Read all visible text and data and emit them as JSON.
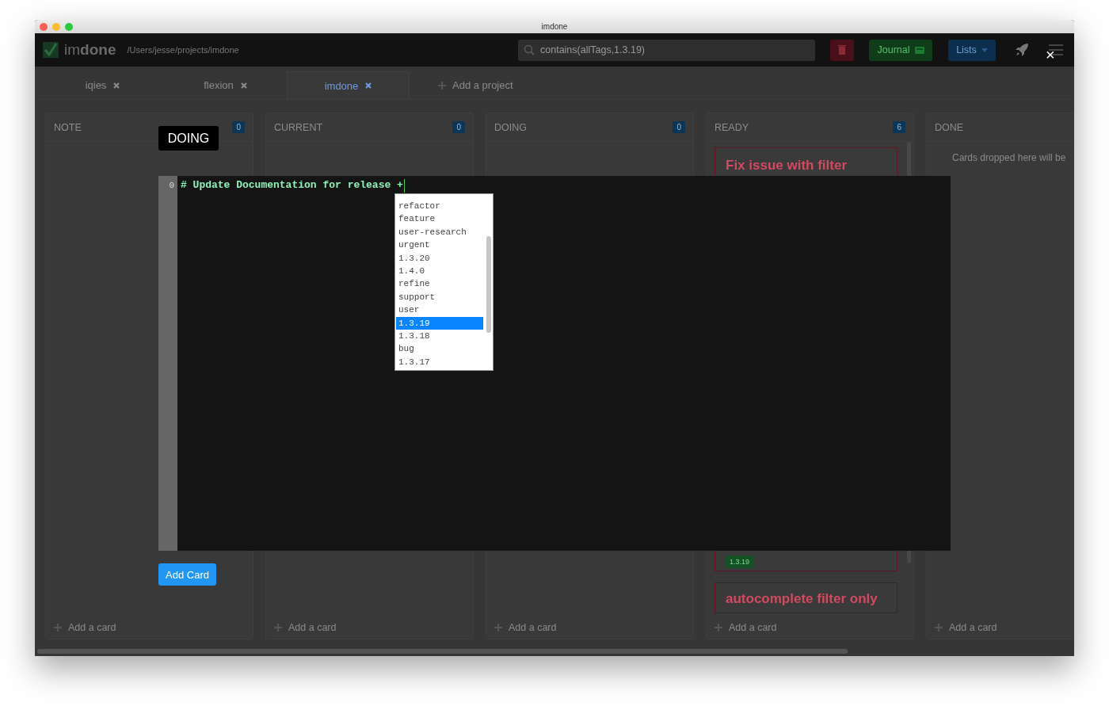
{
  "window": {
    "title": "imdone"
  },
  "header": {
    "logo": "im**done**",
    "path": "/Users/jesse/projects/imdone",
    "search": {
      "value": "contains(allTags,1.3.19)"
    },
    "journal_button": "Journal",
    "lists_button": "Lists"
  },
  "project_tabs": [
    {
      "label": "iqies",
      "selected": false
    },
    {
      "label": "flexion",
      "selected": false
    },
    {
      "label": "imdone",
      "selected": true
    }
  ],
  "add_project": "Add a project",
  "columns": [
    {
      "title": "NOTE",
      "count": "0",
      "add_label": "Add a card"
    },
    {
      "title": "CURRENT",
      "count": "0",
      "add_label": "Add a card"
    },
    {
      "title": "DOING",
      "count": "0",
      "add_label": "Add a card"
    },
    {
      "title": "READY",
      "count": "6",
      "add_label": "Add a card",
      "cards": [
        {
          "title": "Fix issue with filter",
          "tags": [
            "1.3.19"
          ]
        },
        {
          "title": "autocomplete filter only"
        }
      ]
    },
    {
      "title": "DONE",
      "empty_text": "Cards dropped here will be",
      "add_label": "Add a card"
    }
  ],
  "modal": {
    "list_label": "DOING",
    "close": "×",
    "editor": {
      "line_number": "0",
      "text": "# Update Documentation for release +"
    },
    "autocomplete": [
      {
        "label": "refactor",
        "selected": false
      },
      {
        "label": "feature",
        "selected": false
      },
      {
        "label": "user-research",
        "selected": false
      },
      {
        "label": "urgent",
        "selected": false
      },
      {
        "label": "1.3.20",
        "selected": false
      },
      {
        "label": "1.4.0",
        "selected": false
      },
      {
        "label": "refine",
        "selected": false
      },
      {
        "label": "support",
        "selected": false
      },
      {
        "label": "user",
        "selected": false
      },
      {
        "label": "1.3.19",
        "selected": true
      },
      {
        "label": "1.3.18",
        "selected": false
      },
      {
        "label": "bug",
        "selected": false
      },
      {
        "label": "1.3.17",
        "selected": false
      }
    ],
    "add_card_button": "Add Card"
  }
}
